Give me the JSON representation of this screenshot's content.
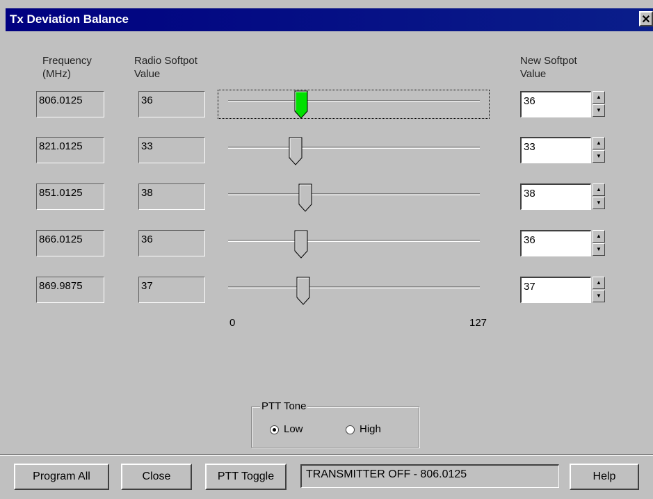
{
  "window": {
    "title": "Tx Deviation Balance",
    "close_glyph": "✕"
  },
  "headers": {
    "frequency_line1": "Frequency",
    "frequency_line2": "(MHz)",
    "radio_line1": "Radio Softpot",
    "radio_line2": "Value",
    "new_line1": "New Softpot",
    "new_line2": "Value"
  },
  "slider_range": {
    "min": 0,
    "max": 127,
    "min_label": "0",
    "max_label": "127"
  },
  "rows": [
    {
      "frequency": "806.0125",
      "radio_value": "36",
      "new_value": "36",
      "slider": 36,
      "active": true
    },
    {
      "frequency": "821.0125",
      "radio_value": "33",
      "new_value": "33",
      "slider": 33,
      "active": false
    },
    {
      "frequency": "851.0125",
      "radio_value": "38",
      "new_value": "38",
      "slider": 38,
      "active": false
    },
    {
      "frequency": "866.0125",
      "radio_value": "36",
      "new_value": "36",
      "slider": 36,
      "active": false
    },
    {
      "frequency": "869.9875",
      "radio_value": "37",
      "new_value": "37",
      "slider": 37,
      "active": false
    }
  ],
  "ptt_tone": {
    "legend": "PTT Tone",
    "low": "Low",
    "high": "High",
    "selected": "Low"
  },
  "buttons": {
    "program_all": "Program All",
    "close": "Close",
    "ptt_toggle": "PTT Toggle",
    "help": "Help"
  },
  "status_text": "TRANSMITTER OFF - 806.0125",
  "colors": {
    "active_thumb": "#00e000",
    "titlebar": "#000080"
  }
}
